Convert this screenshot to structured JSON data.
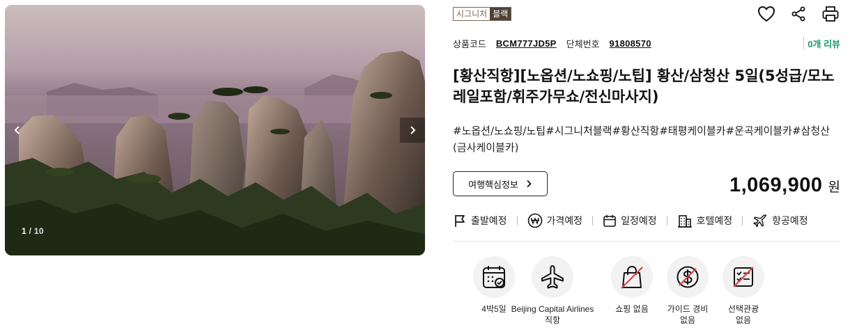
{
  "gallery": {
    "counter_current": "1",
    "counter_total": "10",
    "prev_icon": "chevron-left-icon",
    "next_icon": "chevron-right-icon"
  },
  "badge": {
    "part1": "시그니처",
    "part2": "블랙"
  },
  "actions": {
    "icons": [
      "heart-icon",
      "share-icon",
      "print-icon"
    ]
  },
  "codes": {
    "product_label": "상품코드",
    "product_code": "BCM777JD5P",
    "group_label": "단체번호",
    "group_code": "91808570",
    "review": "0개 리뷰"
  },
  "title": "[황산직항][노옵션/노쇼핑/노팁] 황산/삼청산 5일(5성급/모노레일포함/휘주가무쇼/전신마사지)",
  "tags": "#노옵션/노쇼핑/노팁#시그니처블랙#황산직항#태평케이블카#운곡케이블카#삼청산(금사케이블카)",
  "info_button": "여행핵심정보",
  "price": {
    "amount": "1,069,900",
    "unit": "원"
  },
  "schedule": [
    {
      "label": "출발예정",
      "icon": "flag-icon"
    },
    {
      "label": "가격예정",
      "icon": "won-icon"
    },
    {
      "label": "일정예정",
      "icon": "calendar-icon"
    },
    {
      "label": "호텔예정",
      "icon": "hotel-icon"
    },
    {
      "label": "항공예정",
      "icon": "plane-icon"
    }
  ],
  "features": [
    {
      "line1": "4박5일",
      "line2": "",
      "icon": "calendar-check-icon"
    },
    {
      "line1": "Beijing Capital Airlines",
      "line2": "직항",
      "icon": "airplane-icon"
    },
    {
      "line1": "쇼핑 없음",
      "line2": "",
      "icon": "no-shopping-icon"
    },
    {
      "line1": "가이드 경비",
      "line2": "없음",
      "icon": "no-guide-fee-icon"
    },
    {
      "line1": "선택관광",
      "line2": "없음",
      "icon": "no-optional-tour-icon"
    }
  ],
  "colors": {
    "badge_brown": "#7a6652",
    "badge_dark": "#4e4237",
    "review_green": "#1a9a6c",
    "no_red": "#e04040"
  }
}
